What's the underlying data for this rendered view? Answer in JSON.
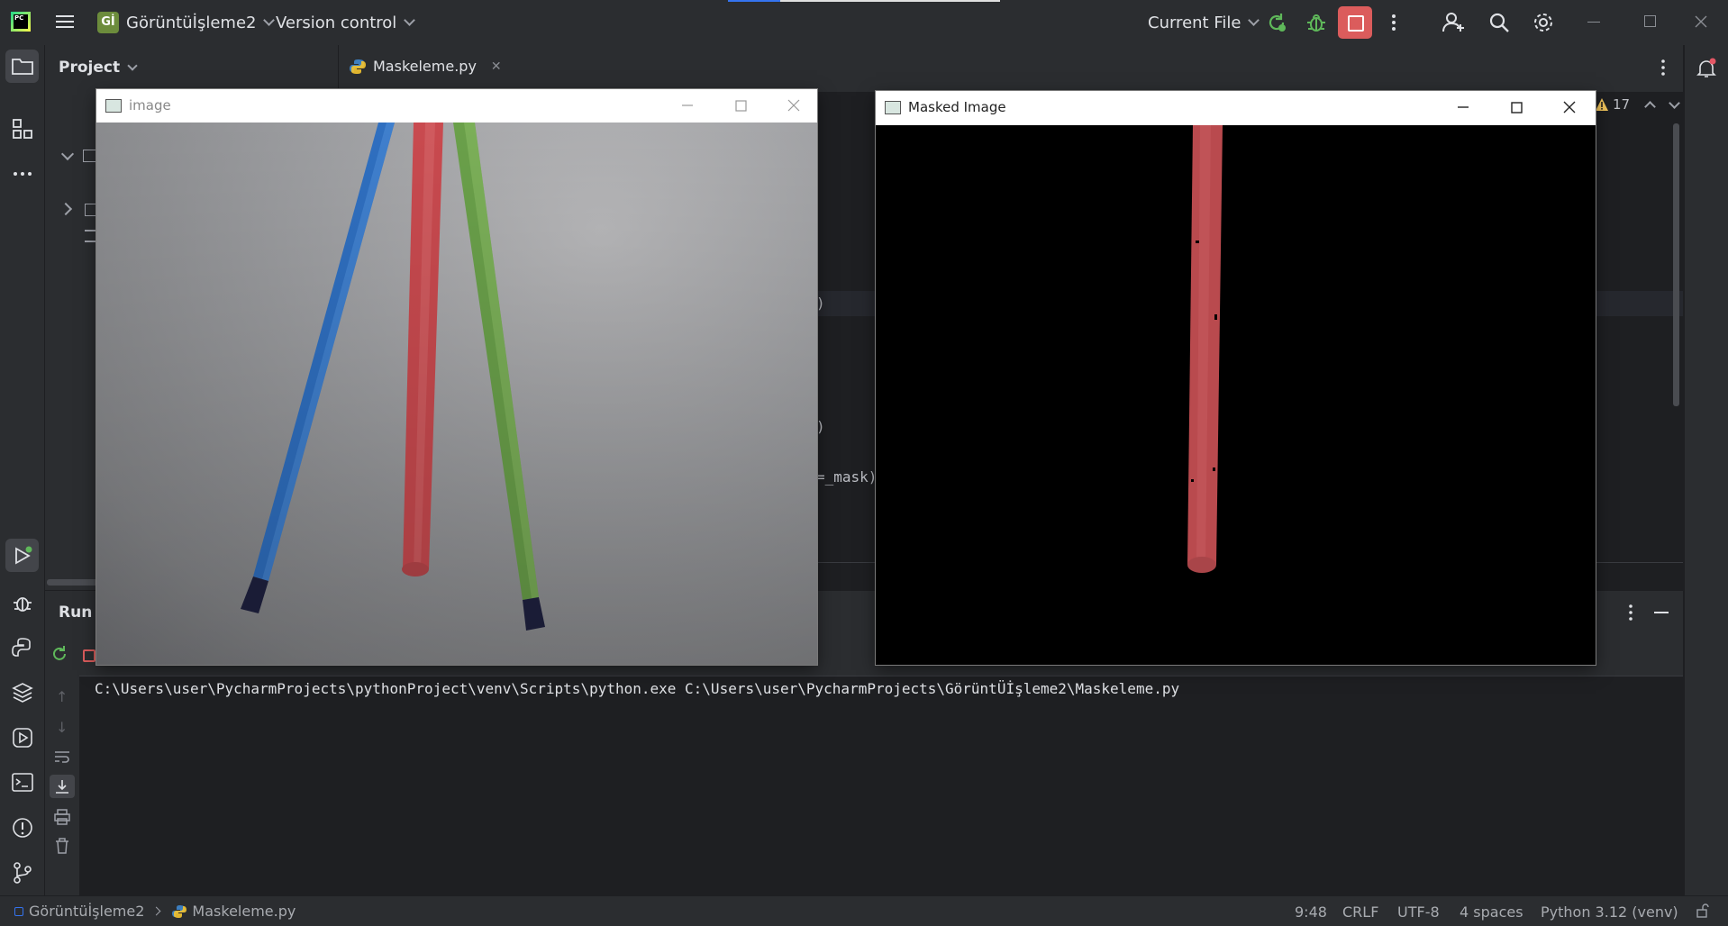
{
  "titlebar": {
    "project_badge": "Gİ",
    "project_name": "Görüntüİşleme2",
    "version_control": "Version control",
    "run_config": "Current File"
  },
  "project_panel": {
    "title": "Project"
  },
  "editor": {
    "tab_file": "Maskeleme.py",
    "inspection_count": "17",
    "code_fragment_1": ")",
    "code_fragment_2": ")",
    "code_fragment_3": "=_mask)"
  },
  "run_panel": {
    "title": "Run",
    "command": "C:\\Users\\user\\PycharmProjects\\pythonProject\\venv\\Scripts\\python.exe C:\\Users\\user\\PycharmProjects\\GörüntÜİşleme2\\Maskeleme.py"
  },
  "image_window": {
    "title": "image"
  },
  "masked_window": {
    "title": "Masked Image"
  },
  "statusbar": {
    "project": "Görüntüİşleme2",
    "file": "Maskeleme.py",
    "position": "9:48",
    "line_sep": "CRLF",
    "encoding": "UTF-8",
    "indent": "4 spaces",
    "interpreter": "Python 3.12 (venv)"
  },
  "colors": {
    "accent_green": "#5fb85a",
    "stop_red": "#db5c5c",
    "ide_bg": "#1e1f22",
    "panel_bg": "#2b2d30"
  }
}
